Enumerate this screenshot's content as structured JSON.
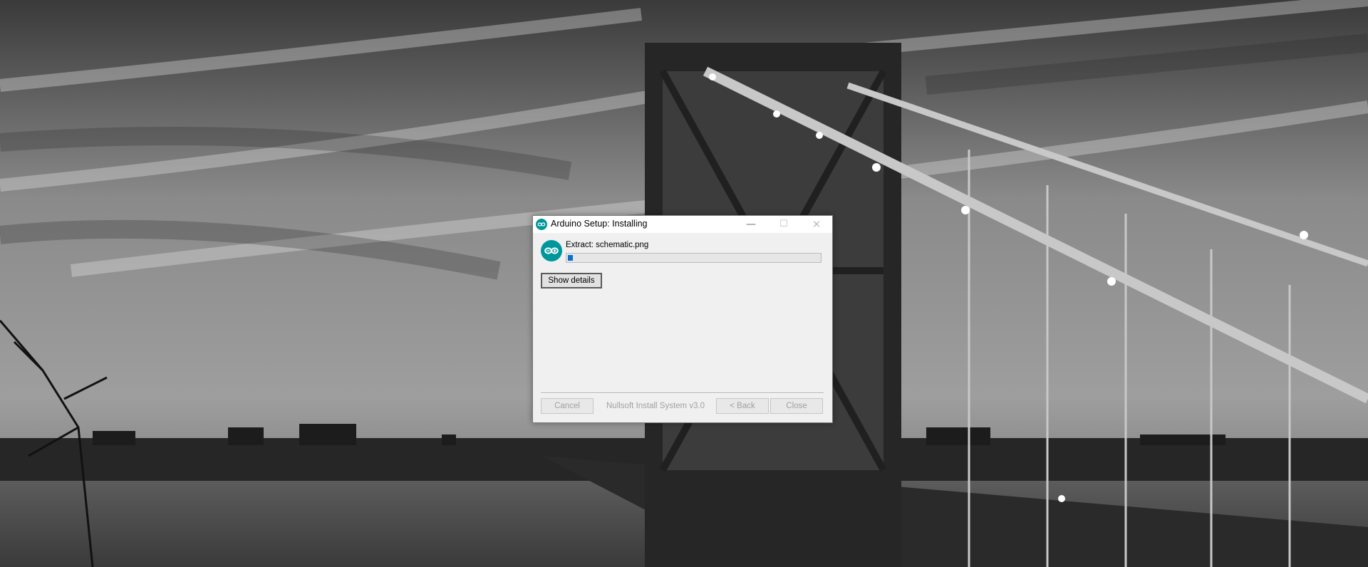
{
  "window": {
    "title": "Arduino Setup: Installing",
    "minimize_glyph": "—",
    "maximize_glyph": "☐",
    "close_glyph": "✕"
  },
  "install": {
    "status_text": "Extract: schematic.png",
    "progress_percent": 2,
    "show_details_label": "Show details"
  },
  "footer": {
    "branding": "Nullsoft Install System v3.0",
    "cancel_label": "Cancel",
    "back_label": "< Back",
    "close_label": "Close"
  },
  "icons": {
    "app": "arduino-logo-icon",
    "header": "arduino-logo-icon"
  },
  "colors": {
    "arduino_teal": "#00979c",
    "progress_blue": "#0a6fd0",
    "dialog_bg": "#f0f0f0"
  }
}
